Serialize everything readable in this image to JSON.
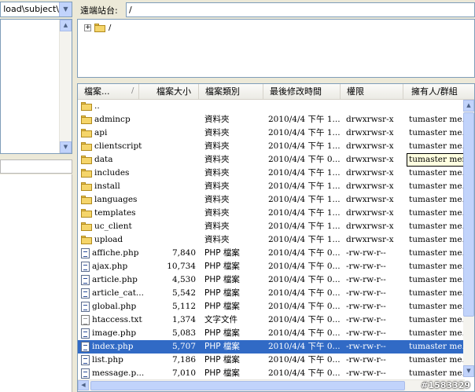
{
  "local": {
    "path": "load\\subject\\"
  },
  "remote": {
    "site_label": "遠端站台:",
    "site_path": "/",
    "tree_root": "/"
  },
  "columns": [
    "檔案...",
    "檔案大小",
    "檔案類別",
    "最後修改時間",
    "權限",
    "擁有人/群組"
  ],
  "sort_indicator": "/",
  "files": [
    {
      "name": "..",
      "size": "",
      "type": "",
      "date": "",
      "perm": "",
      "owner": "",
      "icon": "folder-icon"
    },
    {
      "name": "admincp",
      "size": "",
      "type": "資料夾",
      "date": "2010/4/4 下午 1...",
      "perm": "drwxrwsr-x",
      "owner": "tumaster me...",
      "icon": "folder-icon"
    },
    {
      "name": "api",
      "size": "",
      "type": "資料夾",
      "date": "2010/4/4 下午 1...",
      "perm": "drwxrwsr-x",
      "owner": "tumaster me...",
      "icon": "folder-icon"
    },
    {
      "name": "clientscript",
      "size": "",
      "type": "資料夾",
      "date": "2010/4/4 下午 1...",
      "perm": "drwxrwsr-x",
      "owner": "tumaster me...",
      "icon": "folder-icon"
    },
    {
      "name": "data",
      "size": "",
      "type": "資料夾",
      "date": "2010/4/4 下午 0...",
      "perm": "drwxrwsr-x",
      "owner": "",
      "icon": "folder-icon"
    },
    {
      "name": "includes",
      "size": "",
      "type": "資料夾",
      "date": "2010/4/4 下午 1...",
      "perm": "drwxrwsr-x",
      "owner": "tumaster me...",
      "icon": "folder-icon"
    },
    {
      "name": "install",
      "size": "",
      "type": "資料夾",
      "date": "2010/4/4 下午 1...",
      "perm": "drwxrwsr-x",
      "owner": "tumaster me...",
      "icon": "folder-icon"
    },
    {
      "name": "languages",
      "size": "",
      "type": "資料夾",
      "date": "2010/4/4 下午 1...",
      "perm": "drwxrwsr-x",
      "owner": "tumaster me...",
      "icon": "folder-icon"
    },
    {
      "name": "templates",
      "size": "",
      "type": "資料夾",
      "date": "2010/4/4 下午 1...",
      "perm": "drwxrwsr-x",
      "owner": "tumaster me...",
      "icon": "folder-icon"
    },
    {
      "name": "uc_client",
      "size": "",
      "type": "資料夾",
      "date": "2010/4/4 下午 1...",
      "perm": "drwxrwsr-x",
      "owner": "tumaster me...",
      "icon": "folder-icon"
    },
    {
      "name": "upload",
      "size": "",
      "type": "資料夾",
      "date": "2010/4/4 下午 1...",
      "perm": "drwxrwsr-x",
      "owner": "tumaster me...",
      "icon": "folder-icon"
    },
    {
      "name": "affiche.php",
      "size": "7,840",
      "type": "PHP 檔案",
      "date": "2010/4/4 下午 0...",
      "perm": "-rw-rw-r--",
      "owner": "tumaster me...",
      "icon": "php-file-icon"
    },
    {
      "name": "ajax.php",
      "size": "10,734",
      "type": "PHP 檔案",
      "date": "2010/4/4 下午 0...",
      "perm": "-rw-rw-r--",
      "owner": "tumaster me...",
      "icon": "php-file-icon"
    },
    {
      "name": "article.php",
      "size": "4,530",
      "type": "PHP 檔案",
      "date": "2010/4/4 下午 0...",
      "perm": "-rw-rw-r--",
      "owner": "tumaster me...",
      "icon": "php-file-icon"
    },
    {
      "name": "article_cat...",
      "size": "5,542",
      "type": "PHP 檔案",
      "date": "2010/4/4 下午 0...",
      "perm": "-rw-rw-r--",
      "owner": "tumaster me...",
      "icon": "php-file-icon"
    },
    {
      "name": "global.php",
      "size": "5,112",
      "type": "PHP 檔案",
      "date": "2010/4/4 下午 0...",
      "perm": "-rw-rw-r--",
      "owner": "tumaster me...",
      "icon": "php-file-icon"
    },
    {
      "name": "htaccess.txt",
      "size": "1,374",
      "type": "文字文件",
      "date": "2010/4/4 下午 0...",
      "perm": "-rw-rw-r--",
      "owner": "tumaster me...",
      "icon": "text-file-icon"
    },
    {
      "name": "image.php",
      "size": "5,083",
      "type": "PHP 檔案",
      "date": "2010/4/4 下午 0...",
      "perm": "-rw-rw-r--",
      "owner": "tumaster me...",
      "icon": "php-file-icon"
    },
    {
      "name": "index.php",
      "size": "5,707",
      "type": "PHP 檔案",
      "date": "2010/4/4 下午 0...",
      "perm": "-rw-rw-r--",
      "owner": "tumaster me...",
      "icon": "php-file-icon",
      "selected": true
    },
    {
      "name": "list.php",
      "size": "7,186",
      "type": "PHP 檔案",
      "date": "2010/4/4 下午 0...",
      "perm": "-rw-rw-r--",
      "owner": "tumaster me...",
      "icon": "php-file-icon"
    },
    {
      "name": "message.p...",
      "size": "7,010",
      "type": "PHP 檔案",
      "date": "2010/4/4 下午 0...",
      "perm": "-rw-rw-r--",
      "owner": "tumaster me...",
      "icon": "php-file-icon"
    }
  ],
  "tooltip": "tumaster membres",
  "watermark": "#1583329"
}
